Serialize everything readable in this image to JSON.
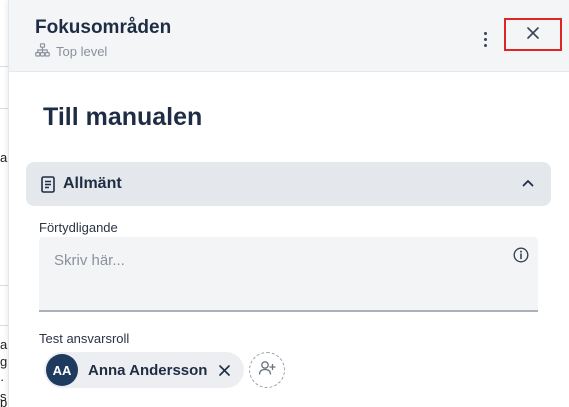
{
  "background": {
    "fragments": [
      "a",
      "a",
      "g",
      "· E",
      "s",
      "p"
    ]
  },
  "header": {
    "title": "Fokusområden",
    "subtitle": "Top level",
    "more_icon": "kebab-menu-icon",
    "close_icon": "close-icon"
  },
  "main": {
    "heading": "Till manualen",
    "section": {
      "label": "Allmänt",
      "icon": "document-icon",
      "expanded": true
    },
    "clarification": {
      "label": "Förtydligande",
      "placeholder": "Skriv här...",
      "value": ""
    },
    "responsibility_role": {
      "label": "Test ansvarsroll",
      "assignees": [
        {
          "initials": "AA",
          "name": "Anna Andersson"
        }
      ]
    }
  },
  "colors": {
    "accent_dark": "#1f3a5f",
    "close_highlight": "#e02424",
    "section_bg": "#e4e7ec"
  }
}
